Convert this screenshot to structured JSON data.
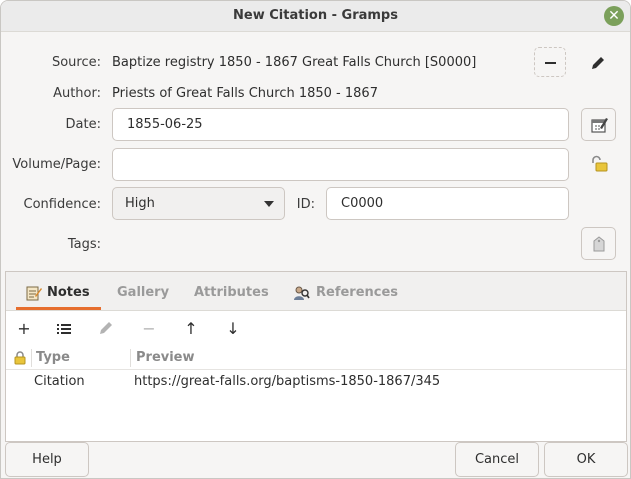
{
  "window": {
    "title": "New Citation - Gramps"
  },
  "form": {
    "source_label": "Source:",
    "source_value": "Baptize registry 1850 - 1867 Great Falls Church [S0000]",
    "author_label": "Author:",
    "author_value": "Priests of Great Falls Church 1850 - 1867",
    "date_label": "Date:",
    "date_value": "1855-06-25",
    "volume_label": "Volume/Page:",
    "volume_value": "",
    "confidence_label": "Confidence:",
    "confidence_value": "High",
    "id_label": "ID:",
    "id_value": "C0000",
    "tags_label": "Tags:"
  },
  "tabs": [
    {
      "label": "Notes",
      "icon": "notes-icon",
      "active": true
    },
    {
      "label": "Gallery",
      "active": false
    },
    {
      "label": "Attributes",
      "active": false
    },
    {
      "label": "References",
      "icon": "references-icon",
      "active": false
    }
  ],
  "toolbar_icons": [
    "add-icon",
    "share-existing-icon",
    "edit-icon",
    "remove-icon",
    "move-up-icon",
    "move-down-icon"
  ],
  "notes_table": {
    "columns": [
      "Type",
      "Preview"
    ],
    "rows": [
      {
        "type": "Citation",
        "preview": "https://great-falls.org/baptisms-1850-1867/345"
      }
    ]
  },
  "footer": {
    "help_label": "Help",
    "cancel_label": "Cancel",
    "ok_label": "OK"
  },
  "colors": {
    "accent": "#e66e2e",
    "close": "#7ba05b"
  }
}
